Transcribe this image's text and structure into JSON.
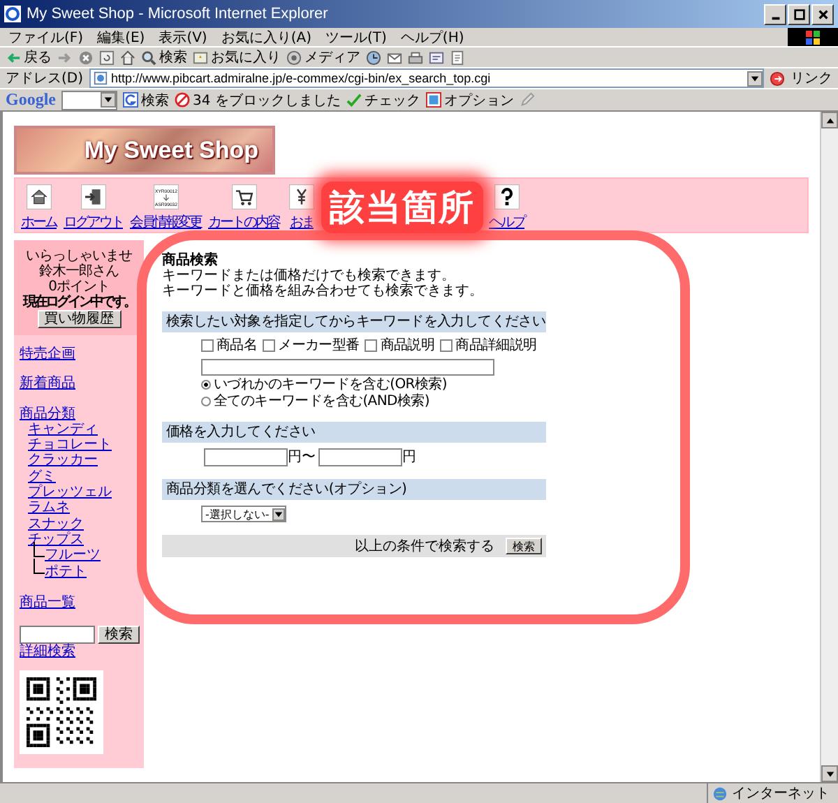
{
  "window": {
    "title": "My Sweet Shop - Microsoft Internet Explorer"
  },
  "menu": [
    "ファイル(F)",
    "編集(E)",
    "表示(V)",
    "お気に入り(A)",
    "ツール(T)",
    "ヘルプ(H)"
  ],
  "toolbar": [
    {
      "kind": "back",
      "label": "戻る"
    },
    {
      "kind": "forward"
    },
    {
      "kind": "stop"
    },
    {
      "kind": "refresh"
    },
    {
      "kind": "home"
    },
    {
      "kind": "search",
      "label": "検索"
    },
    {
      "kind": "favorites",
      "label": "お気に入り"
    },
    {
      "kind": "media",
      "label": "メディア"
    },
    {
      "kind": "history"
    },
    {
      "kind": "mail"
    },
    {
      "kind": "print"
    },
    {
      "kind": "edit"
    },
    {
      "kind": "discuss"
    }
  ],
  "address": {
    "label": "アドレス(D)",
    "url": "http://www.pibcart.admiralne.jp/e-commex/cgi-bin/ex_search_top.cgi",
    "links": "リンク"
  },
  "google_bar": {
    "logo": "Google",
    "search": "検索",
    "blocked": "34 をブロックしました",
    "check": "チェック",
    "options": "オプション"
  },
  "banner": {
    "title": "My Sweet Shop"
  },
  "nav": [
    {
      "kind": "home",
      "label": "ホーム"
    },
    {
      "kind": "logout",
      "label": "ログアウト"
    },
    {
      "kind": "member",
      "label": "会員情報変更",
      "icon_lines": [
        "XYR00012",
        "ASR99032"
      ]
    },
    {
      "kind": "cart",
      "label": "カートの内容"
    },
    {
      "kind": "payment",
      "label": "おま"
    },
    {
      "kind": "help",
      "label": "ヘルプ"
    }
  ],
  "callout": {
    "label": "該当箇所"
  },
  "sidebar": {
    "welcome": [
      "いらっしゃいませ",
      "鈴木一郎さん",
      "0ポイント"
    ],
    "login_status": "現在ログイン中です。",
    "history_button": "買い物履歴",
    "links": [
      {
        "label": "特売企画"
      },
      {
        "label": "新着商品"
      },
      {
        "label": "商品分類",
        "children": [
          {
            "label": "キャンディ"
          },
          {
            "label": "チョコレート"
          },
          {
            "label": "クラッカー"
          },
          {
            "label": "グミ"
          },
          {
            "label": "プレッツェル"
          },
          {
            "label": "ラムネ"
          },
          {
            "label": "スナック"
          },
          {
            "label": "チップス",
            "children": [
              {
                "label": "フルーツ"
              },
              {
                "label": "ポテト"
              }
            ]
          }
        ]
      },
      {
        "label": "商品一覧"
      }
    ],
    "search_button": "検索",
    "advanced_search": "詳細検索"
  },
  "search_form": {
    "title": "商品検索",
    "intro": [
      "キーワードまたは価格だけでも検索できます。",
      "キーワードと価格を組み合わせても検索できます。"
    ],
    "keyword_header": "検索したい対象を指定してからキーワードを入力してください",
    "targets": [
      {
        "label": "商品名",
        "checked": false
      },
      {
        "label": "メーカー型番",
        "checked": false
      },
      {
        "label": "商品説明",
        "checked": false
      },
      {
        "label": "商品詳細説明",
        "checked": false
      }
    ],
    "modes": [
      {
        "label": "いづれかのキーワードを含む(OR検索)",
        "selected": true
      },
      {
        "label": "全てのキーワードを含む(AND検索)",
        "selected": false
      }
    ],
    "price_header": "価格を入力してください",
    "yen_from": "円〜",
    "yen_to": "円",
    "category_header": "商品分類を選んでください(オプション)",
    "category_select": "-選択しない-",
    "submit_text": "以上の条件で検索する",
    "submit_button": "検索"
  },
  "status_bar": {
    "zone": "インターネット"
  }
}
